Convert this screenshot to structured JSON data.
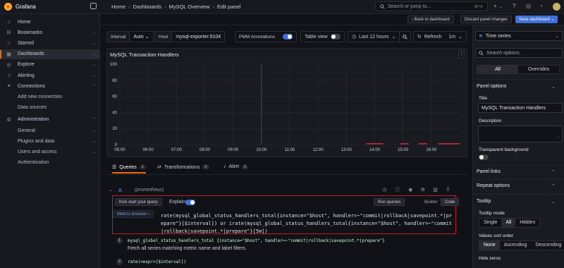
{
  "app": {
    "name": "Grafana"
  },
  "breadcrumb": [
    "Home",
    "Dashboards",
    "MySQL Overview",
    "Edit panel"
  ],
  "search": {
    "placeholder": "Search or jump to...",
    "shortcut": "⌘+k"
  },
  "topbar": {
    "plus": "+",
    "help": "?"
  },
  "sidebar": {
    "items": [
      {
        "label": "Home",
        "icon": "home-icon",
        "chev": ""
      },
      {
        "label": "Bookmarks",
        "icon": "bookmark-icon",
        "chev": "⌄"
      },
      {
        "label": "Starred",
        "icon": "star-icon",
        "chev": "⌄"
      },
      {
        "label": "Dashboards",
        "icon": "dashboards-icon",
        "chev": "⌄",
        "active": true
      },
      {
        "label": "Explore",
        "icon": "compass-icon",
        "chev": "⌄"
      },
      {
        "label": "Alerting",
        "icon": "bell-icon",
        "chev": "⌄"
      },
      {
        "label": "Connections",
        "icon": "plug-icon",
        "chev": "⌃"
      },
      {
        "label": "Add new connection",
        "sub": true
      },
      {
        "label": "Data sources",
        "sub": true
      },
      {
        "label": "Administration",
        "icon": "gear-icon",
        "chev": "⌃"
      },
      {
        "label": "General",
        "sub": true,
        "chev": "⌄"
      },
      {
        "label": "Plugins and data",
        "sub": true,
        "chev": "⌄"
      },
      {
        "label": "Users and access",
        "sub": true,
        "chev": "⌄"
      },
      {
        "label": "Authentication",
        "sub": true
      }
    ]
  },
  "actions": {
    "back": "Back to dashboard",
    "discard": "Discard panel changes",
    "save": "Save dashboard"
  },
  "variables": {
    "interval_label": "Interval",
    "interval_value": "Auto",
    "host_label": "Host",
    "host_value": "mysql-exporter:9104",
    "pmm_label": "PMM Annotations"
  },
  "toolbar": {
    "table_view": "Table view",
    "time_range": "Last 12 hours",
    "refresh": "Refresh",
    "refresh_interval": "1m"
  },
  "panel": {
    "title": "MySQL Transaction Handlers"
  },
  "chart_data": {
    "type": "line",
    "title": "MySQL Transaction Handlers",
    "x": [
      "05:00",
      "06:00",
      "07:00",
      "08:00",
      "09:00",
      "10:00",
      "11:00",
      "12:00",
      "13:00",
      "14:00",
      "15:00",
      "16:00"
    ],
    "yticks": [
      "0",
      "20",
      "40",
      "60",
      "80",
      "100"
    ],
    "ylim": [
      0,
      100
    ],
    "grid": true,
    "series_color": "#e02f44",
    "segments": [
      {
        "from": 13.7,
        "to": 14.3,
        "value": 1
      },
      {
        "from": 14.9,
        "to": 15.2,
        "value": 1
      },
      {
        "from": 15.55,
        "to": 15.85,
        "value": 1
      },
      {
        "from": 16.25,
        "to": 17.0,
        "value": 1
      }
    ],
    "marker_at": 10.0
  },
  "query_tabs": [
    {
      "label": "Queries",
      "count": "1"
    },
    {
      "label": "Transformations",
      "count": "0"
    },
    {
      "label": "Alert",
      "count": "0"
    }
  ],
  "query": {
    "ref": "A",
    "datasource": "(prometheus)",
    "kickstart": "Kick start your query",
    "explain": "Explain",
    "run": "Run queries",
    "builder": "Builder",
    "code": "Code",
    "metrics_browser": "Metrics browser ›",
    "expr": "rate(mysql_global_status_handlers_total{instance=\"$host\", handler=~\"commit|rollback|savepoint.*|prepare\"}[$interval]) or irate(mysql_global_status_handlers_total{instance=\"$host\", handler=~\"commit|rollback|savepoint.*|prepare\"}[5m])",
    "hint1_num": "1",
    "hint1_code": "mysql_global_status_handlers_total {instance=\"$host\", handler=~\"commit|rollback|savepoint.*|prepare\"}",
    "hint1_desc": "Fetch all series matching metric name and label filters.",
    "hint2_num": "2",
    "hint2_code": "rate(<expr>[$interval])"
  },
  "options": {
    "viz": "Time series",
    "search_placeholder": "Search options",
    "tab_all": "All",
    "tab_overrides": "Overrides",
    "panel_options": "Panel options",
    "title_label": "Title",
    "title_value": "MySQL Transaction Handlers",
    "description_label": "Description",
    "transparent_label": "Transparent background",
    "panel_links": "Panel links",
    "repeat_options": "Repeat options",
    "tooltip": "Tooltip",
    "tooltip_mode": "Tooltip mode",
    "mode_single": "Single",
    "mode_all": "All",
    "mode_hidden": "Hidden",
    "sort_label": "Values sort order",
    "sort_none": "None",
    "sort_asc": "Ascending",
    "sort_desc": "Descending",
    "hide_zeros": "Hide zeros"
  }
}
